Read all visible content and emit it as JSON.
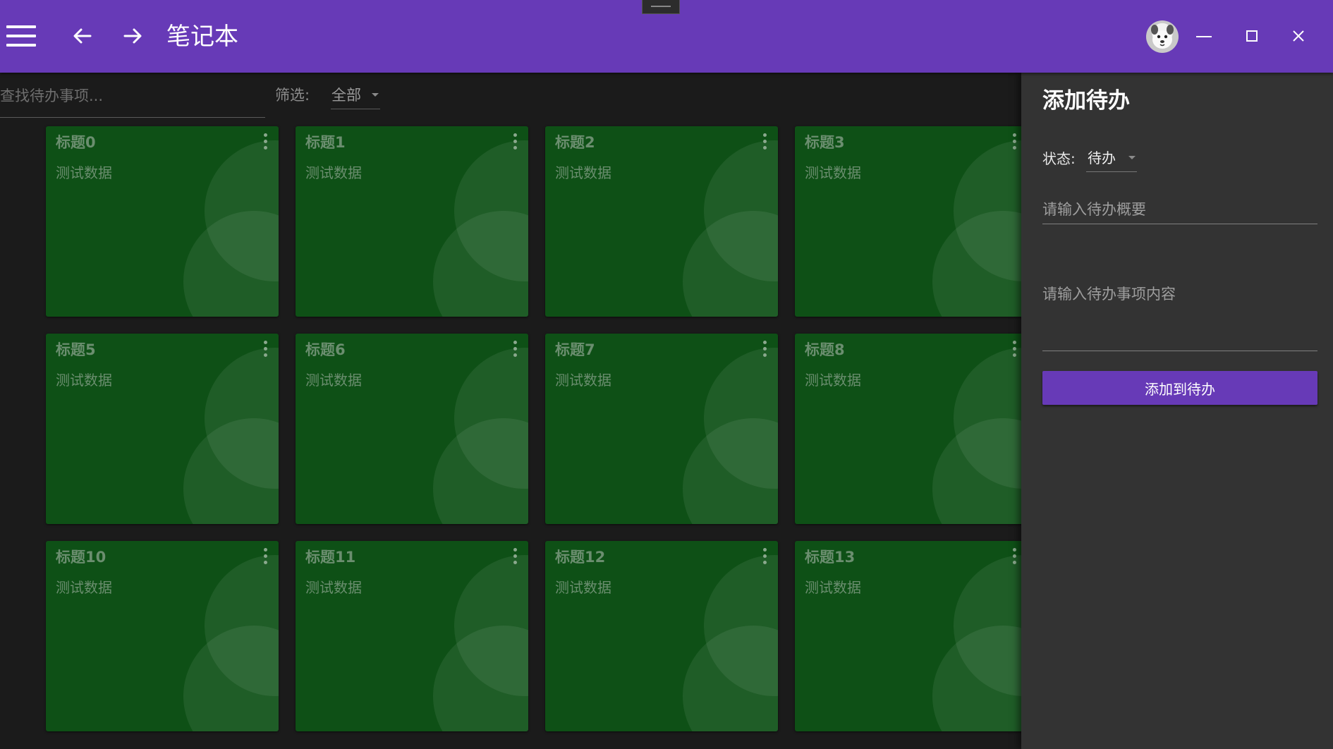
{
  "app": {
    "title": "笔记本"
  },
  "colors": {
    "primary": "#673ab7",
    "card": "#0e5016",
    "panel": "#333333",
    "background": "#1b1b1b"
  },
  "header": {
    "icons": [
      "hamburger-menu-icon",
      "arrow-left-icon",
      "arrow-right-icon",
      "avatar",
      "minimize-icon",
      "maximize-icon",
      "close-icon"
    ]
  },
  "filters": {
    "search_placeholder": "查找待办事项...",
    "filter_label": "筛选:",
    "filter_value": "全部"
  },
  "cards": [
    {
      "title": "标题0",
      "content": "测试数据"
    },
    {
      "title": "标题1",
      "content": "测试数据"
    },
    {
      "title": "标题2",
      "content": "测试数据"
    },
    {
      "title": "标题3",
      "content": "测试数据"
    },
    {
      "title": "标题5",
      "content": "测试数据"
    },
    {
      "title": "标题6",
      "content": "测试数据"
    },
    {
      "title": "标题7",
      "content": "测试数据"
    },
    {
      "title": "标题8",
      "content": "测试数据"
    },
    {
      "title": "标题10",
      "content": "测试数据"
    },
    {
      "title": "标题11",
      "content": "测试数据"
    },
    {
      "title": "标题12",
      "content": "测试数据"
    },
    {
      "title": "标题13",
      "content": "测试数据"
    }
  ],
  "panel": {
    "title": "添加待办",
    "status_label": "状态:",
    "status_value": "待办",
    "summary_placeholder": "请输入待办概要",
    "content_placeholder": "请输入待办事项内容",
    "add_button": "添加到待办"
  }
}
